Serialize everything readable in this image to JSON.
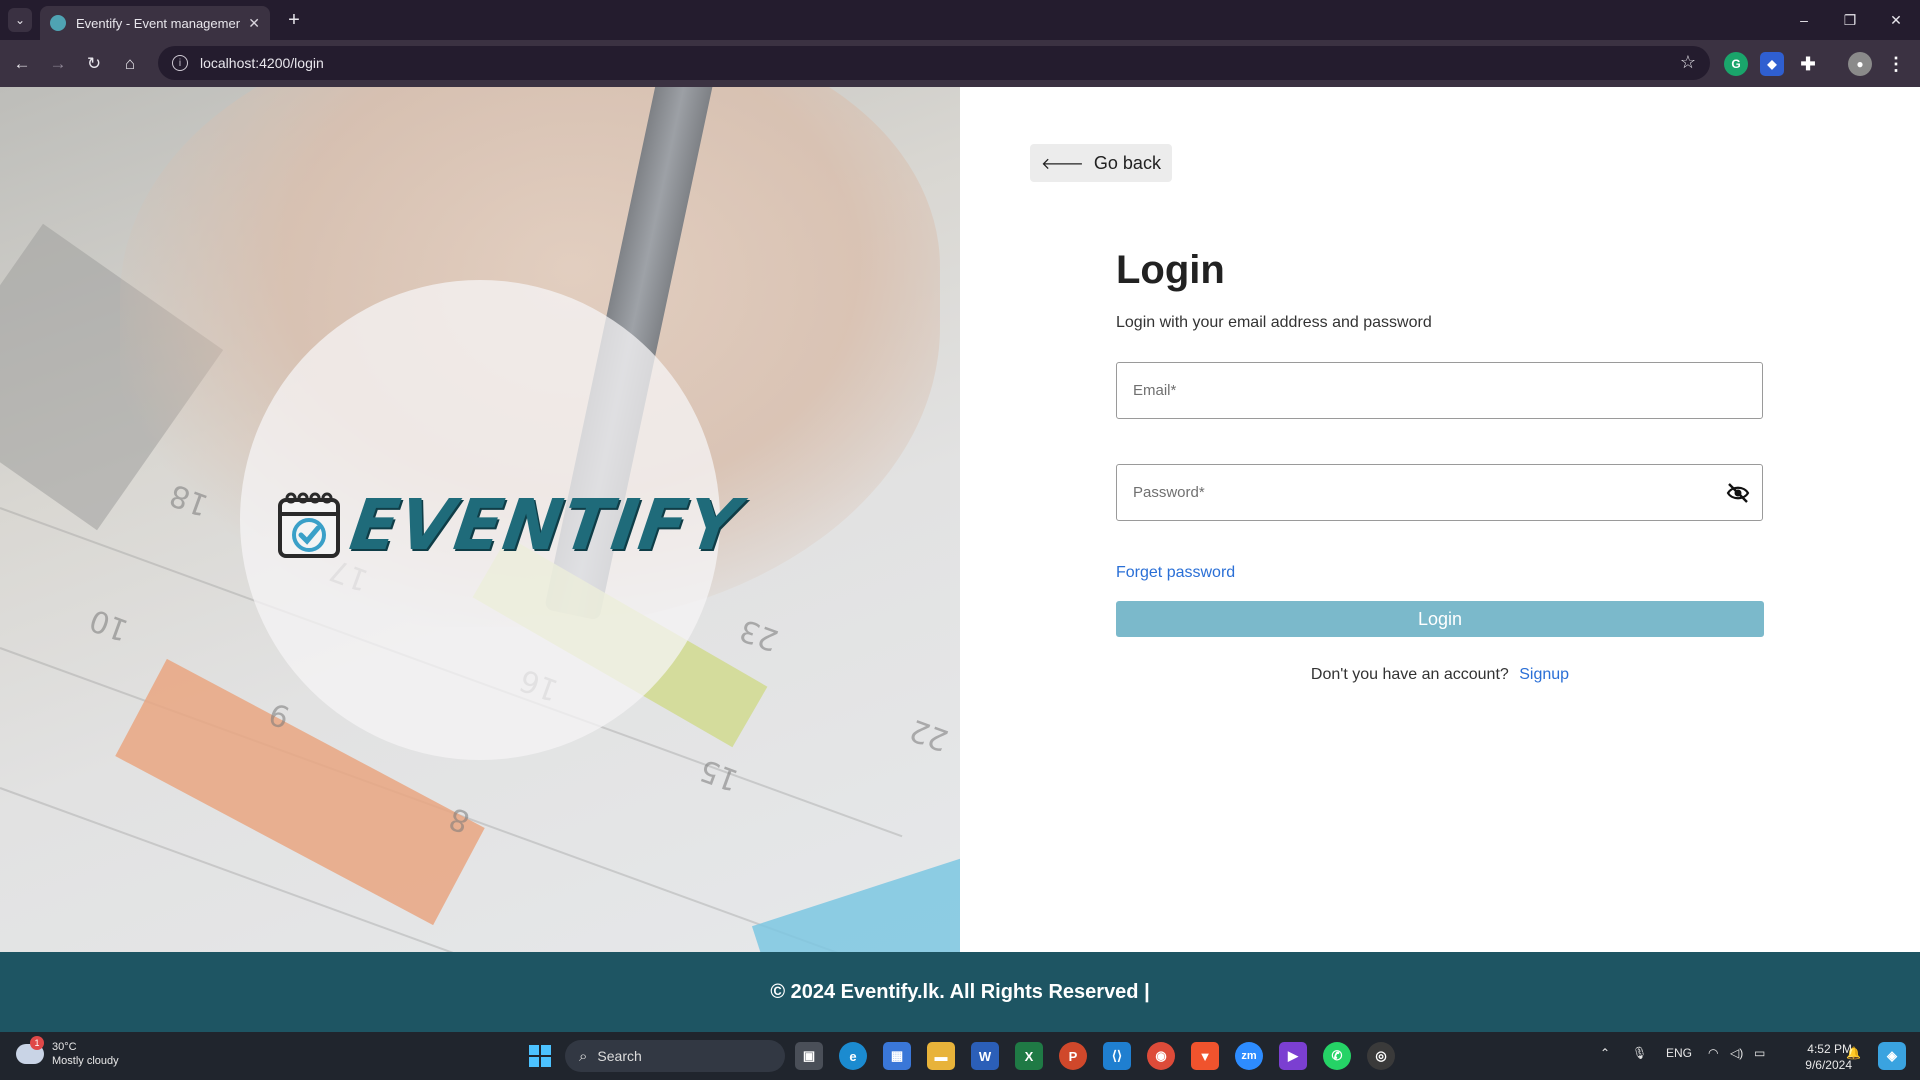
{
  "browser": {
    "tab_title": "Eventify - Event management s",
    "url": "localhost:4200/login",
    "new_tab_label": "+",
    "window_controls": {
      "minimize": "–",
      "restore": "❐",
      "close": "✕"
    }
  },
  "hero": {
    "logo_text": "EVENTIFY",
    "calendar_numbers": [
      "18",
      "17",
      "10",
      "16",
      "23",
      "9",
      "15",
      "22",
      "8"
    ]
  },
  "login": {
    "go_back_label": "Go back",
    "title": "Login",
    "subtitle": "Login with your email address and password",
    "email_placeholder": "Email*",
    "password_placeholder": "Password*",
    "forget_password": "Forget password",
    "login_button": "Login",
    "signup_question": "Don't you have an account?",
    "signup_link": "Signup"
  },
  "footer": {
    "text": "© 2024 Eventify.lk. All Rights Reserved |"
  },
  "taskbar": {
    "weather_temp": "30°C",
    "weather_desc": "Mostly cloudy",
    "weather_badge": "1",
    "search_label": "Search",
    "language": "ENG",
    "time": "4:52 PM",
    "date": "9/6/2024",
    "apps": [
      "windows-start",
      "task-view",
      "edge",
      "store",
      "file-explorer",
      "word",
      "excel",
      "powerpoint",
      "vscode",
      "chrome",
      "brave",
      "zoom",
      "visual-studio",
      "whatsapp",
      "obs"
    ]
  },
  "colors": {
    "footer_bg": "#1e5563",
    "login_button_bg": "#7bb9cb",
    "link": "#2a6fd6",
    "brand_teal": "#1f6b7a"
  }
}
